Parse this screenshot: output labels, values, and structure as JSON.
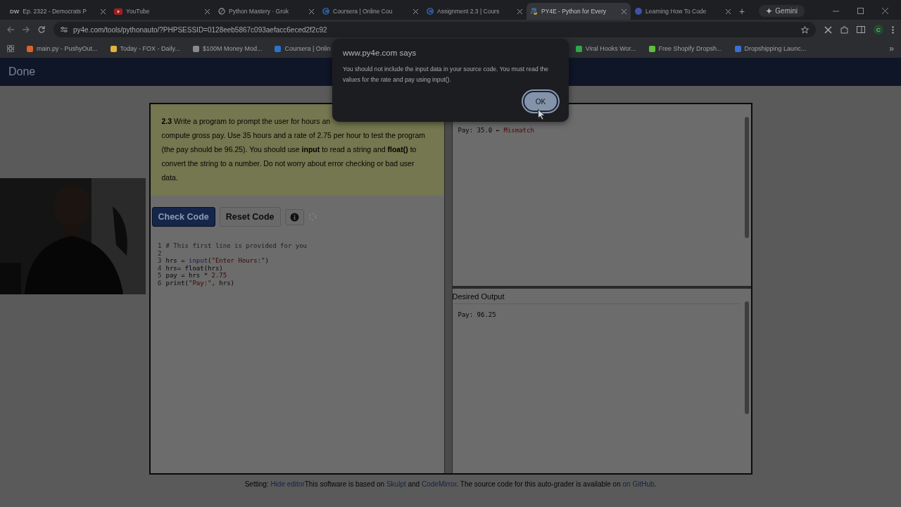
{
  "browser": {
    "tabs": [
      {
        "title": "Ep. 2322 - Democrats P",
        "kind": "text",
        "favicon_text": "DW",
        "selected": false
      },
      {
        "title": "YouTube",
        "kind": "youtube",
        "selected": false
      },
      {
        "title": "Python Mastery · Grok",
        "kind": "grok",
        "selected": false
      },
      {
        "title": "Coursera | Online Cou",
        "kind": "coursera",
        "selected": false
      },
      {
        "title": "Assignment 2.3 | Cours",
        "kind": "coursera",
        "selected": false
      },
      {
        "title": "PY4E - Python for Every",
        "kind": "python",
        "selected": true
      },
      {
        "title": "Learning How To Code",
        "kind": "circle",
        "selected": false
      }
    ],
    "new_tab": "+",
    "gemini": "Gemini",
    "address": "py4e.com/tools/pythonauto/?PHPSESSID=0128eeb5867c093aefacc6eced2f2c92",
    "profile": "C",
    "bookmarks": [
      {
        "title": "main.py - PushyOut...",
        "color": "#d9622b"
      },
      {
        "title": "Today - FOX - Daily...",
        "color": "#e0b43a"
      },
      {
        "title": "$100M Money Mod...",
        "color": "#8a8a8a"
      },
      {
        "title": "Coursera | Onlin",
        "color": "#2a73cc"
      },
      {
        "title": "Viral Hooks Wor...",
        "color": "#2ea84a"
      },
      {
        "title": "Free Shopify Dropsh...",
        "color": "#5fbf3a"
      },
      {
        "title": "Dropshipping Launc...",
        "color": "#3b6fd8"
      }
    ],
    "more_bookmarks": "»"
  },
  "header": {
    "title": "Done"
  },
  "problem": {
    "lines": [
      "**2.3** Write a program to prompt the user for hours an",
      "compute gross pay. Use 35 hours and a rate of 2.75 per hour to test the program",
      "(the pay should be 96.25). You should use **input** to read a string and **float()** to",
      "convert the string to a number. Do not worry about error checking or bad user",
      "data."
    ]
  },
  "buttons": [
    {
      "label": "Check Code",
      "kind": "primary"
    },
    {
      "label": "Reset Code",
      "kind": "secondary"
    },
    {
      "kind": "info"
    },
    {
      "kind": "spinner"
    }
  ],
  "code": [
    {
      "number": "1",
      "tokens": [
        {
          "text": "# This first line is provided for you",
          "kind": "comment"
        }
      ]
    },
    {
      "number": "2"
    },
    {
      "number": "3",
      "tokens": [
        {
          "text": "hrs = ",
          "kind": "plain"
        },
        {
          "text": "input",
          "kind": "builtin"
        },
        {
          "text": "(",
          "kind": "plain"
        },
        {
          "text": "\"Enter Hours:\"",
          "kind": "string"
        },
        {
          "text": ")",
          "kind": "plain"
        }
      ]
    },
    {
      "number": "4",
      "tokens": [
        {
          "text": "hrs= float(hrs)",
          "kind": "plain"
        }
      ]
    },
    {
      "number": "5",
      "tokens": [
        {
          "text": "pay = hrs * ",
          "kind": "plain"
        },
        {
          "text": "2.75",
          "kind": "number"
        }
      ]
    },
    {
      "number": "6",
      "tokens": [
        {
          "text": "print(",
          "kind": "plain"
        },
        {
          "text": "\"Pay:\"",
          "kind": "string"
        },
        {
          "text": ", hrs)",
          "kind": "plain"
        }
      ]
    }
  ],
  "output": {
    "tokens": [
      {
        "text": "Pay: 35.0 ← ",
        "kind": "plain"
      },
      {
        "text": "Mismatch",
        "kind": "error"
      }
    ]
  },
  "desired": {
    "title": "Desired Output",
    "tokens": [
      {
        "text": "Pay: 96.25",
        "kind": "plain"
      }
    ]
  },
  "footer": [
    {
      "text": "Setting: ",
      "kind": "plain"
    },
    {
      "text": "Hide editor",
      "kind": "link"
    },
    {
      "text": "This software is based on ",
      "kind": "plain"
    },
    {
      "text": "Skulpt",
      "kind": "link"
    },
    {
      "text": " and ",
      "kind": "plain"
    },
    {
      "text": "CodeMirror",
      "kind": "link"
    },
    {
      "text": ". The source code for this auto-grader is available on ",
      "kind": "plain"
    },
    {
      "text": "on GitHub",
      "kind": "link"
    },
    {
      "text": ".",
      "kind": "plain"
    }
  ],
  "dialog": {
    "title": "www.py4e.com says",
    "message": "You should not include the input data in your source code. You must read the values for the rate and pay using input().",
    "ok": "OK"
  }
}
